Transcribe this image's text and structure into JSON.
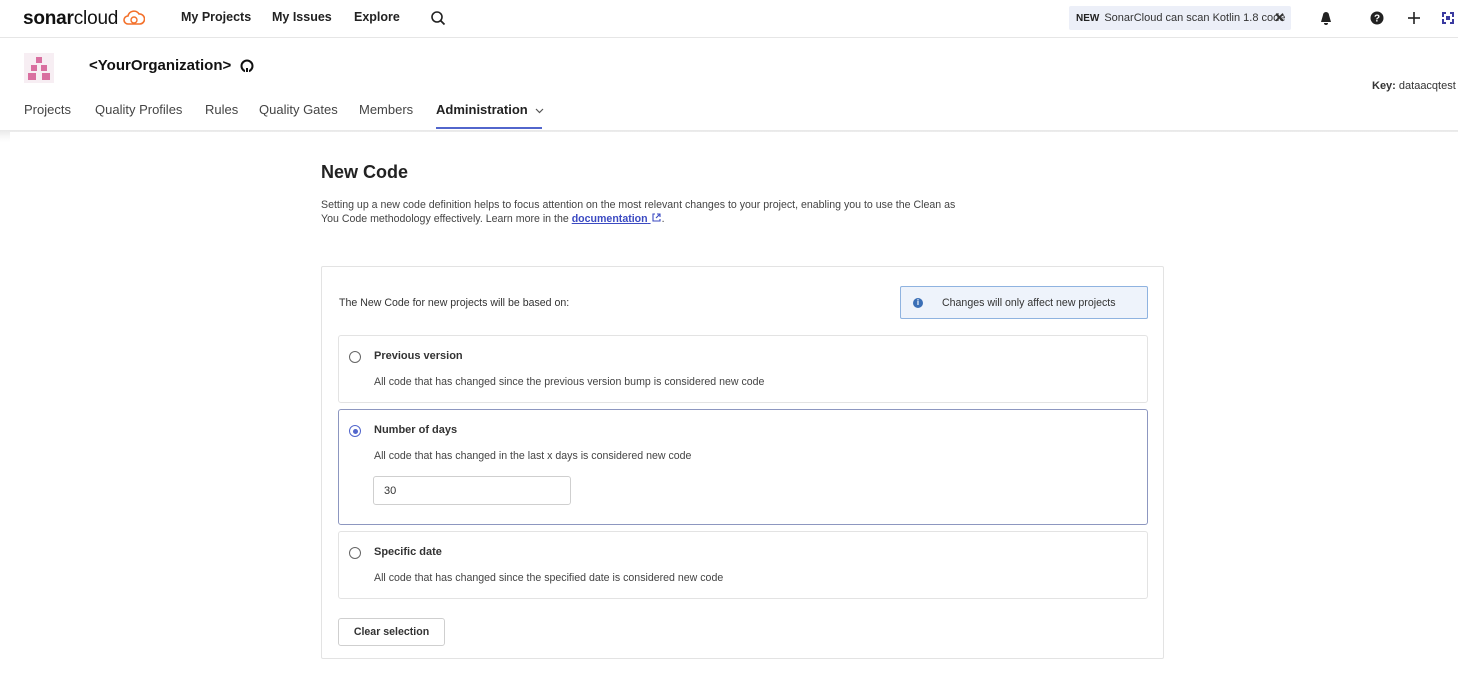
{
  "topbar": {
    "logo_bold": "sonar",
    "logo_light": "cloud",
    "nav": [
      "My Projects",
      "My Issues",
      "Explore"
    ],
    "news_badge": "NEW",
    "news_text": "SonarCloud can scan Kotlin 1.8 code",
    "news_close": "✕",
    "icons": [
      "search-icon",
      "bell-icon",
      "help-icon",
      "plus-icon",
      "user-avatar"
    ]
  },
  "org": {
    "name": "<YourOrganization>",
    "key_label": "Key:",
    "key_value": "dataacqtest"
  },
  "subnav": {
    "items": [
      "Projects",
      "Quality Profiles",
      "Rules",
      "Quality Gates",
      "Members",
      "Administration"
    ],
    "active": "Administration"
  },
  "page": {
    "title": "New Code",
    "description": "Setting up a new code definition helps to focus attention on the most relevant changes to your project, enabling you to use the Clean as You Code methodology effectively. Learn more in the",
    "doc_link": "documentation",
    "desc_end": "."
  },
  "card": {
    "based_on": "The New Code for new projects will be based on:",
    "info": "Changes will only affect new projects",
    "options": [
      {
        "title": "Previous version",
        "desc": "All code that has changed since the previous version bump is considered new code",
        "selected": false
      },
      {
        "title": "Number of days",
        "desc": "All code that has changed in the last x days is considered new code",
        "selected": true,
        "value": "30"
      },
      {
        "title": "Specific date",
        "desc": "All code that has changed since the specified date is considered new code",
        "selected": false
      }
    ],
    "clear_label": "Clear selection"
  },
  "colors": {
    "accent": "#5266cc",
    "link": "#3b4ac2",
    "logo_orange": "#f3702a",
    "info_bg": "#eef3fb"
  }
}
